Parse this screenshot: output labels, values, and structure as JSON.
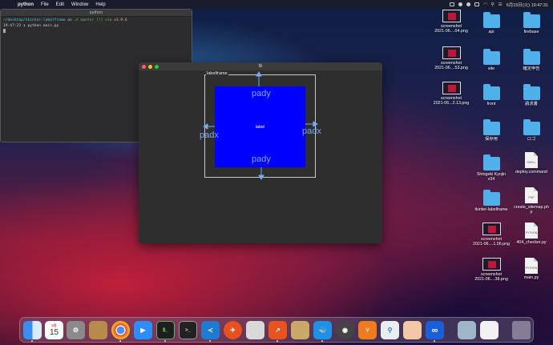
{
  "menubar": {
    "app": "python",
    "items": [
      "File",
      "Edit",
      "Window",
      "Help"
    ],
    "clock": "6月15日(火)  19:47:31"
  },
  "terminal": {
    "title": "python",
    "line1_path": "~/desktop/tkinter-labelframe",
    "line1_on": " on ",
    "line1_branch": "master [!] via ",
    "line1_py": "v3.9.6",
    "line2_time": "19:47:23",
    "line2_cmd": " ❯ python main.py"
  },
  "tk": {
    "title": "tk",
    "labelframe_text": "labelframe",
    "label_text": "label",
    "pady": "pady",
    "padx": "padx"
  },
  "desktop": {
    "icons": [
      {
        "caption": "screenshot\n2021-06....04.png",
        "kind": "thumb"
      },
      {
        "caption": "api",
        "kind": "folder"
      },
      {
        "caption": "firebase",
        "kind": "folder"
      },
      {
        "caption": "screenshot\n2021-06....53.png",
        "kind": "thumb"
      },
      {
        "caption": "site",
        "kind": "folder"
      },
      {
        "caption": "確定申告",
        "kind": "folder"
      },
      {
        "caption": "screenshot\n2021-06...2.13.png",
        "kind": "thumb"
      },
      {
        "caption": "front",
        "kind": "folder"
      },
      {
        "caption": "請求書",
        "kind": "folder"
      },
      {
        "caption": "保存用",
        "kind": "folder"
      },
      {
        "caption": "ロゴ",
        "kind": "folder"
      },
      {
        "caption": "Shingeki Kyojin\nv34",
        "kind": "folder"
      },
      {
        "caption": "deploy.command",
        "kind": "doc",
        "badge": "SHELL"
      },
      {
        "caption": "tkinter-labelframe",
        "kind": "folder"
      },
      {
        "caption": "create_sitemap.ph\np",
        "kind": "doc",
        "badge": "PHP"
      },
      {
        "caption": "screenshot\n2021-06....1.06.png",
        "kind": "thumb"
      },
      {
        "caption": "404_checker.py",
        "kind": "doc",
        "badge": "PYTHON"
      },
      {
        "caption": "screenshot\n2021-06....38.png",
        "kind": "thumb"
      },
      {
        "caption": "main.py",
        "kind": "doc",
        "badge": "PYTHON"
      }
    ]
  },
  "dock": {
    "calendar_month": "6月",
    "calendar_day": "15"
  },
  "colors": {
    "label_bg": "#0000ff",
    "annotation": "#7aa9f0",
    "folder": "#4fb0ec"
  }
}
